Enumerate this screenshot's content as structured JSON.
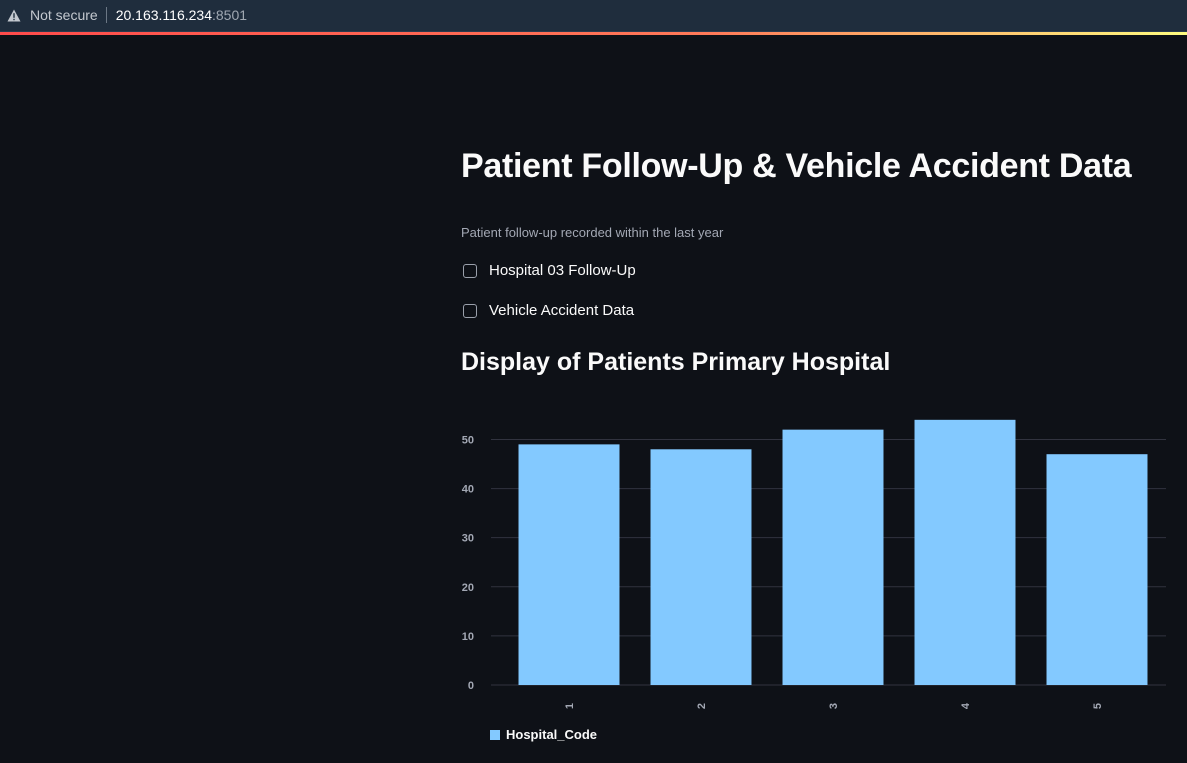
{
  "browser": {
    "security_label": "Not secure",
    "url_host": "20.163.116.234",
    "url_port": ":8501"
  },
  "page": {
    "title": "Patient Follow-Up & Vehicle Accident Data",
    "caption": "Patient follow-up recorded within the last year",
    "checkboxes": [
      {
        "label": "Hospital 03 Follow-Up",
        "checked": false
      },
      {
        "label": "Vehicle Accident Data",
        "checked": false
      }
    ],
    "section_title": "Display of Patients Primary Hospital"
  },
  "chart_data": {
    "type": "bar",
    "categories": [
      "1",
      "2",
      "3",
      "4",
      "5"
    ],
    "series": [
      {
        "name": "Hospital_Code",
        "values": [
          49,
          48,
          52,
          54,
          47
        ]
      }
    ],
    "yticks": [
      0,
      10,
      20,
      30,
      40,
      50
    ],
    "ylim": [
      0,
      56
    ],
    "grid": true,
    "legend": "bottom-left",
    "bar_color": "#83c9ff",
    "grid_color": "#31333f",
    "tick_color": "#a3a8b4",
    "xlabel": "",
    "ylabel": "",
    "title": ""
  },
  "colors": {
    "background": "#0e1117",
    "browser_bar": "#1f2d3d",
    "accent": "#ff4b4b"
  }
}
